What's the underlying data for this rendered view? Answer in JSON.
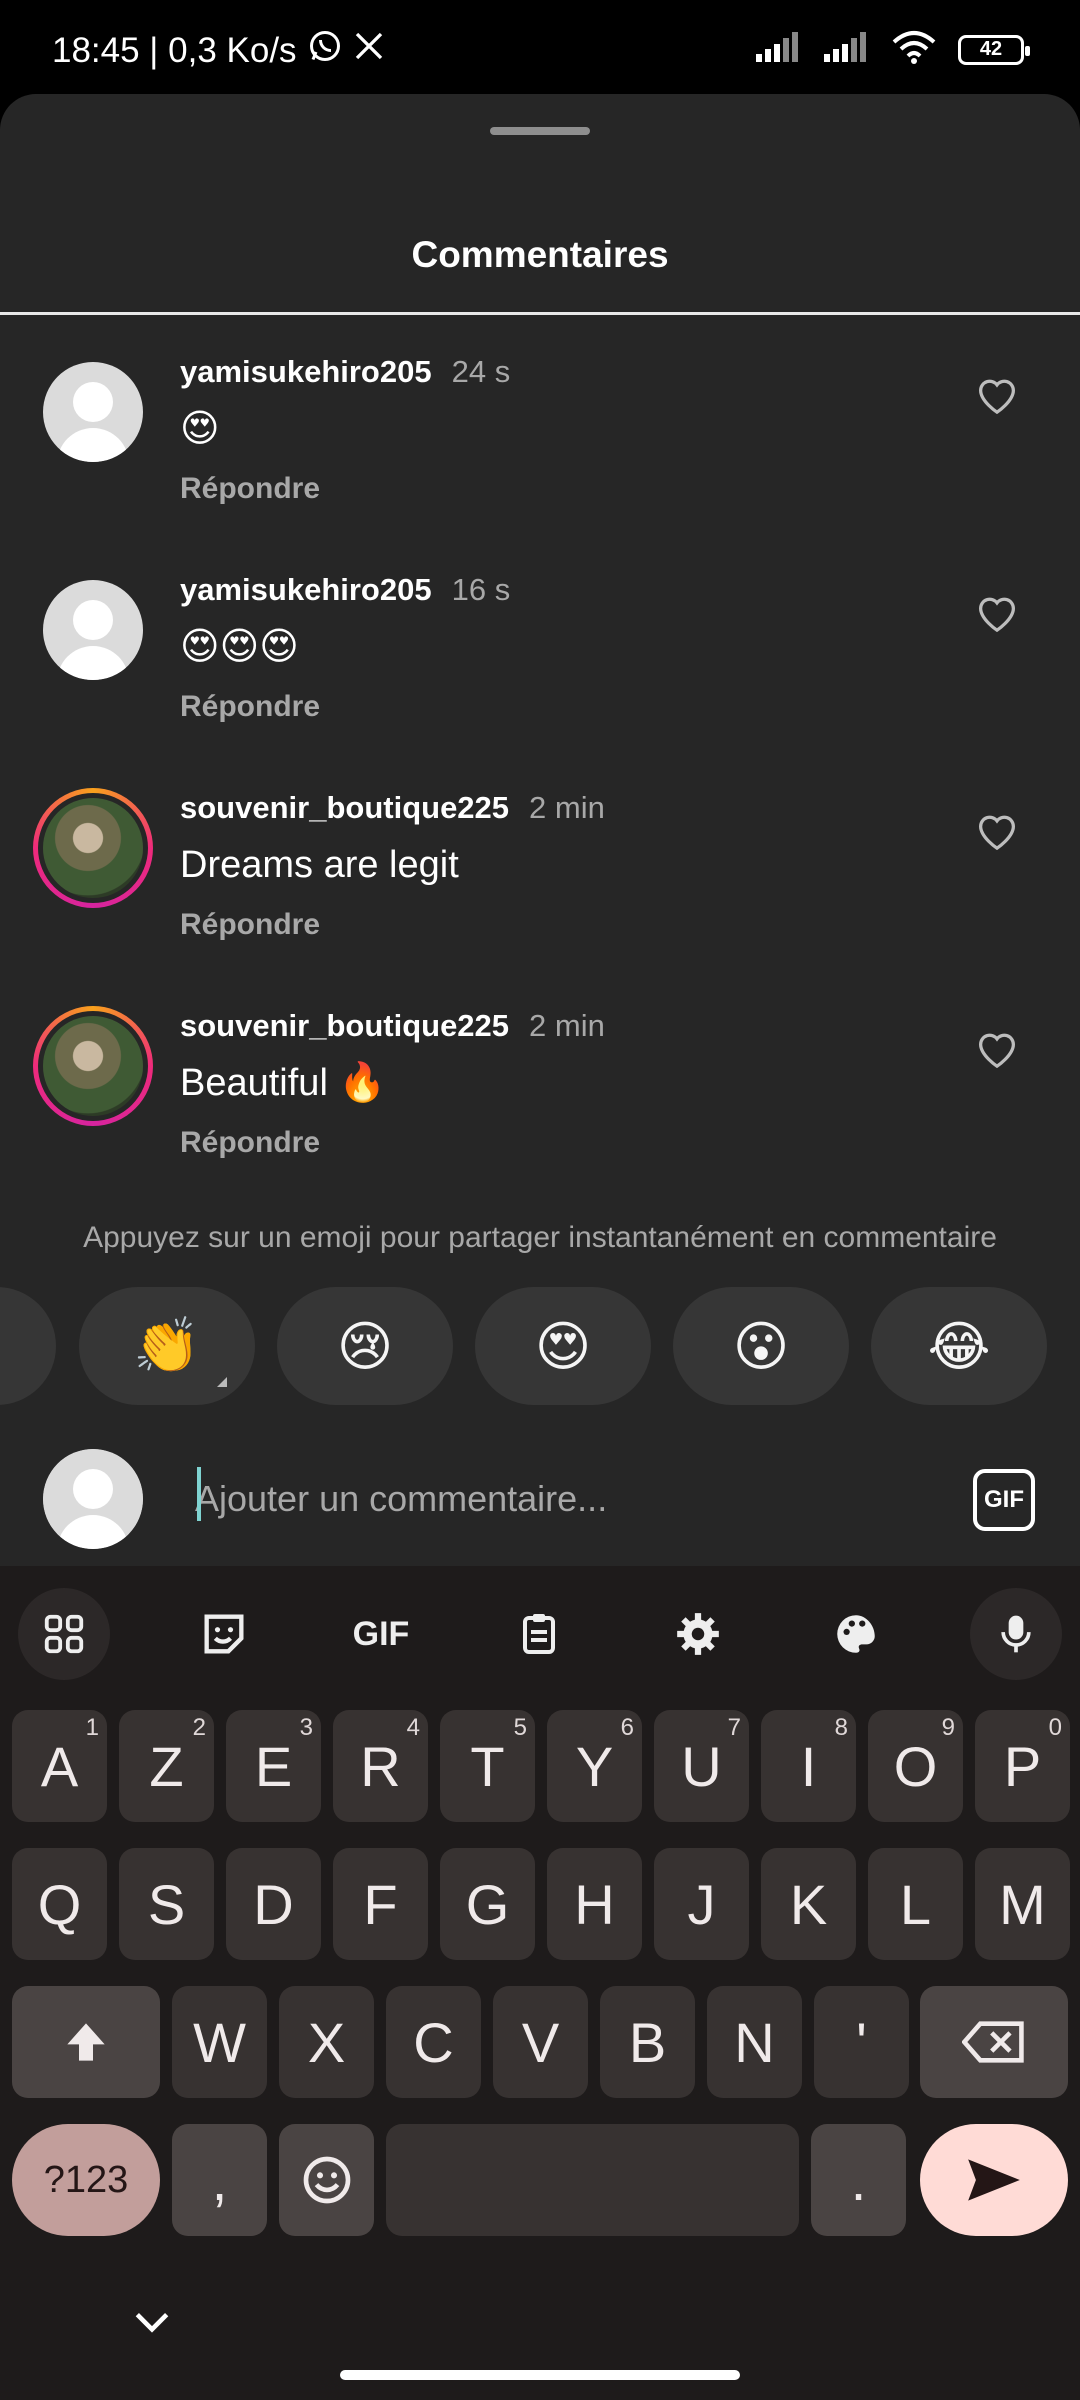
{
  "status_bar": {
    "time_and_speed": "18:45 | 0,3 Ko/s",
    "battery": "42"
  },
  "sheet": {
    "title": "Commentaires"
  },
  "comments": [
    {
      "user": "yamisukehiro205",
      "time": "24 s",
      "text": "😍",
      "reply": "Répondre",
      "avatar": "default"
    },
    {
      "user": "yamisukehiro205",
      "time": "16 s",
      "text": "😍😍😍",
      "reply": "Répondre",
      "avatar": "default"
    },
    {
      "user": "souvenir_boutique225",
      "time": "2 min",
      "text": "Dreams are legit",
      "reply": "Répondre",
      "avatar": "story-photo"
    },
    {
      "user": "souvenir_boutique225",
      "time": "2 min",
      "text": "Beautiful 🔥",
      "reply": "Répondre",
      "avatar": "story-photo"
    }
  ],
  "emoji_hint": "Appuyez sur un emoji pour partager instantanément en commentaire",
  "quick_emojis": [
    "👏",
    "😢",
    "😍",
    "😮",
    "😂"
  ],
  "composer": {
    "placeholder": "Ajouter un commentaire...",
    "gif_label": "GIF"
  },
  "keyboard": {
    "toolbar_gif": "GIF",
    "row1": [
      {
        "k": "A",
        "n": "1"
      },
      {
        "k": "Z",
        "n": "2"
      },
      {
        "k": "E",
        "n": "3"
      },
      {
        "k": "R",
        "n": "4"
      },
      {
        "k": "T",
        "n": "5"
      },
      {
        "k": "Y",
        "n": "6"
      },
      {
        "k": "U",
        "n": "7"
      },
      {
        "k": "I",
        "n": "8"
      },
      {
        "k": "O",
        "n": "9"
      },
      {
        "k": "P",
        "n": "0"
      }
    ],
    "row2": [
      "Q",
      "S",
      "D",
      "F",
      "G",
      "H",
      "J",
      "K",
      "L",
      "M"
    ],
    "row3": [
      "W",
      "X",
      "C",
      "V",
      "B",
      "N",
      "'"
    ],
    "symbols_label": "?123",
    "comma": ",",
    "period": "."
  },
  "colors": {
    "sheet_bg": "#262626",
    "keyboard_bg": "#1e1b1b",
    "accent_cursor": "#7fd3d1",
    "symbols_key": "#c29e9b",
    "send_key": "#ffdbd6"
  }
}
